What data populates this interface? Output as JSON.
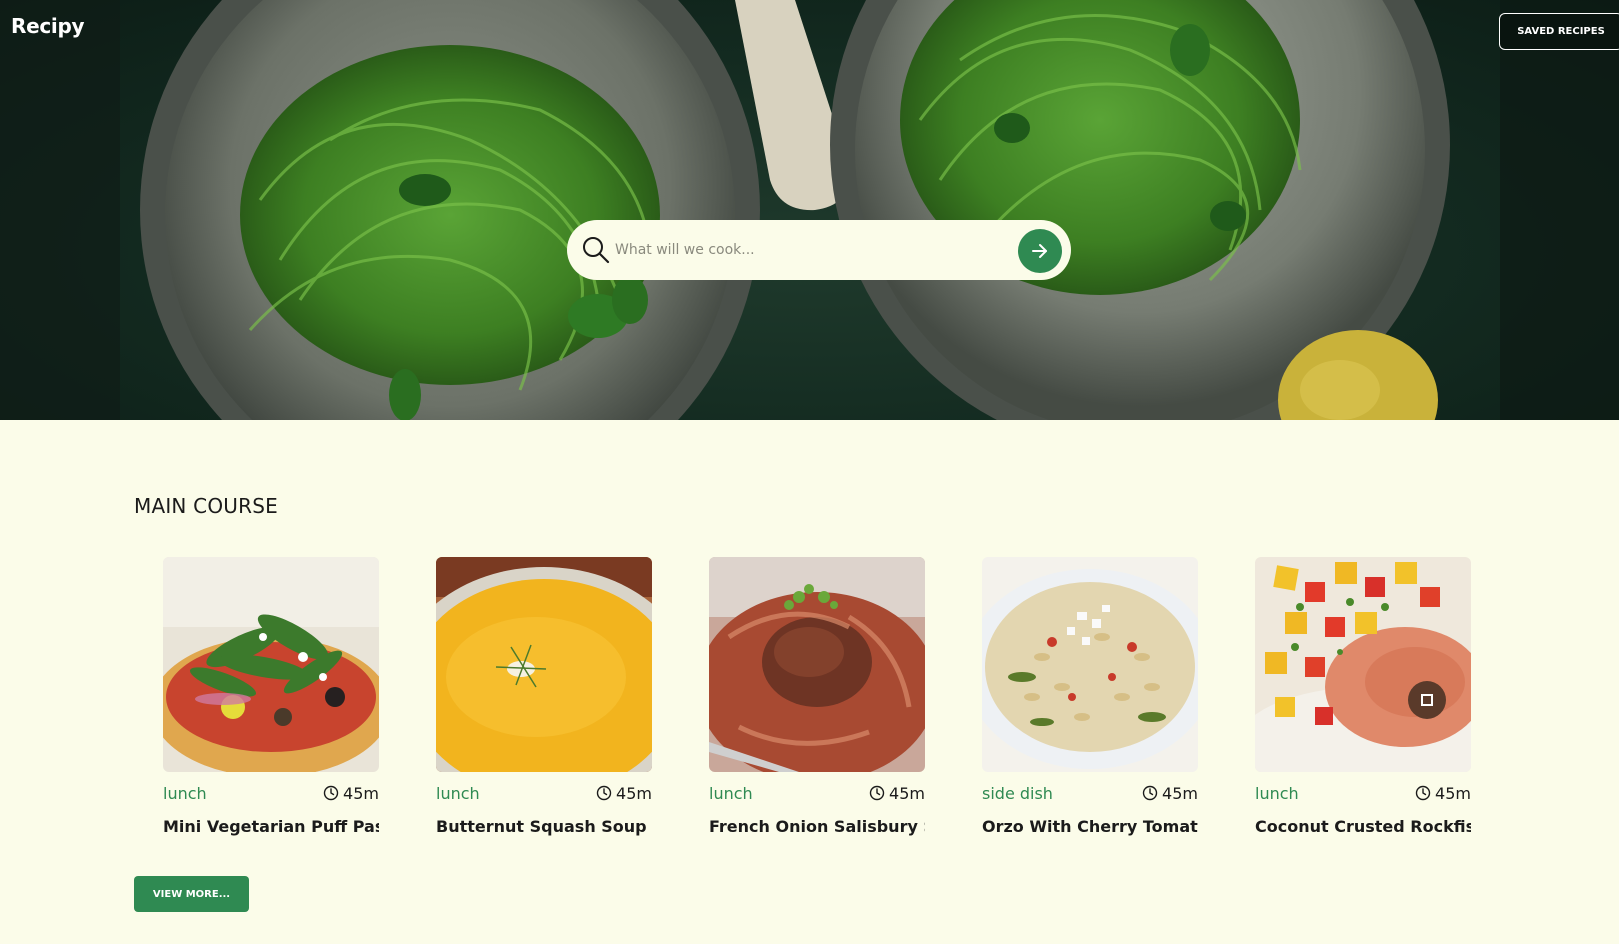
{
  "app": {
    "title": "Recipy"
  },
  "header": {
    "saved_label": "SAVED RECIPES"
  },
  "search": {
    "placeholder": "What will we cook...",
    "value": ""
  },
  "section": {
    "title": "MAIN COURSE"
  },
  "recipes": [
    {
      "category": "lunch",
      "time": "45m",
      "title": "Mini Vegetarian Puff Pas..."
    },
    {
      "category": "lunch",
      "time": "45m",
      "title": "Butternut Squash Soup w..."
    },
    {
      "category": "lunch",
      "time": "45m",
      "title": "French Onion Salisbury S..."
    },
    {
      "category": "side dish",
      "time": "45m",
      "title": "Orzo With Cherry Tomat..."
    },
    {
      "category": "lunch",
      "time": "45m",
      "title": "Coconut Crusted Rockfish"
    }
  ],
  "footer": {
    "view_more_label": "VIEW MORE..."
  },
  "icons": {
    "search": "search-icon",
    "go": "arrow-right-icon",
    "clock": "clock-icon",
    "stop": "stop-icon"
  },
  "colors": {
    "accent": "#2f8a52",
    "background": "#fbfce9",
    "hero_dark": "#132a20"
  }
}
